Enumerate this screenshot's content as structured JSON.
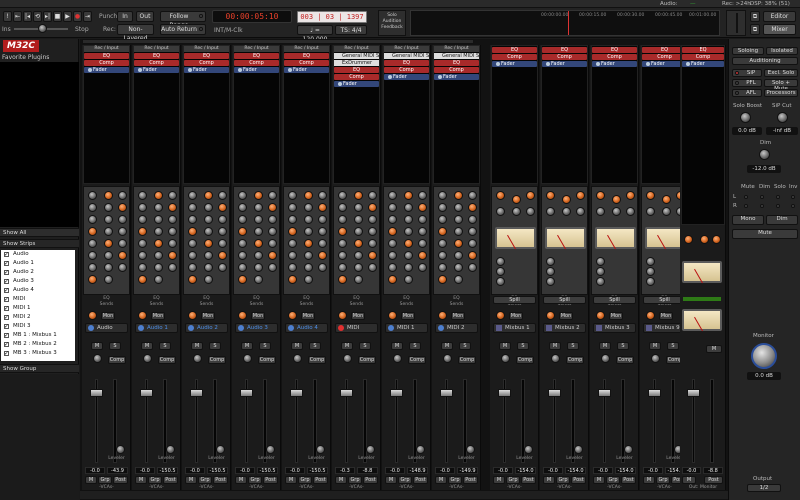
{
  "status": {
    "audio_label": "Audio:",
    "rec": "Rec: >24h",
    "dsp": "DSP: 38% (51)"
  },
  "toolbar": {
    "punch_label": "Punch:",
    "in": "In",
    "out": "Out",
    "follow_range": "Follow Range",
    "rec_label": "Rec:",
    "non_layered": "Non-Layered",
    "auto_return": "Auto Return",
    "timecode": "00:00:05:10",
    "bbt": "003 | 03 | 1397",
    "clock_source": "INT/M-Clk",
    "tempo": "♩ = 120.000",
    "timesig": "TS: 4/4",
    "solo": "Solo",
    "audition": "Audition",
    "feedback": "Feedback",
    "stop": "Stop",
    "ins_label": "Ins",
    "ruler": [
      "00:00:00.00",
      "00:00:15.00",
      "00:00:30.00",
      "00:00:45.00",
      "00:01:00.00"
    ],
    "editor": "Editor",
    "mixer": "Mixer"
  },
  "left": {
    "logo": "M32C",
    "favorites": "Favorite Plugins",
    "show_all": "Show All",
    "strips_header": "Show  Strips",
    "group_header": "Show  Group",
    "strips": [
      "Audio",
      "Audio 1",
      "Audio 2",
      "Audio 3",
      "Audio 4",
      "MIDI",
      "MIDI 1",
      "MIDI 2",
      "MIDI 3",
      "MB 1 : Mixbus 1",
      "MB 2 : Mixbus 2",
      "MB 3 : Mixbus 3"
    ]
  },
  "strips": [
    {
      "name": "Audio",
      "kind": "audio",
      "insert_hdr": "Rec / Input",
      "inserts": [
        "EQ",
        "Comp"
      ],
      "fader_val": "-0.0",
      "peak": "-43.9"
    },
    {
      "name": "Audio 1",
      "kind": "audio",
      "insert_hdr": "Rec / Input",
      "inserts": [
        "EQ",
        "Comp"
      ],
      "fader_val": "-0.0",
      "peak": "-150.5"
    },
    {
      "name": "Audio 2",
      "kind": "audio",
      "insert_hdr": "Rec / Input",
      "inserts": [
        "EQ",
        "Comp"
      ],
      "fader_val": "-0.0",
      "peak": "-150.5"
    },
    {
      "name": "Audio 3",
      "kind": "audio",
      "insert_hdr": "Rec / Input",
      "inserts": [
        "EQ",
        "Comp"
      ],
      "fader_val": "-0.0",
      "peak": "-150.5"
    },
    {
      "name": "Audio 4",
      "kind": "audio",
      "insert_hdr": "Rec / Input",
      "inserts": [
        "EQ",
        "Comp"
      ],
      "fader_val": "-0.0",
      "peak": "-150.5"
    },
    {
      "name": "MIDI",
      "kind": "midi",
      "insert_hdr": "Rec / Input",
      "inserts": [
        "General MIDI Sy",
        "ExDrummer",
        "EQ",
        "Comp"
      ],
      "fader_val": "-0.3",
      "peak": "-8.8"
    },
    {
      "name": "MIDI 1",
      "kind": "midi",
      "insert_hdr": "Rec / Input",
      "inserts": [
        "General MIDI Sy",
        "EQ",
        "Comp"
      ],
      "fader_val": "-0.0",
      "peak": "-148.9"
    },
    {
      "name": "MIDI 2",
      "kind": "midi",
      "insert_hdr": "Rec / Input",
      "inserts": [
        "General MIDI Sy",
        "EQ",
        "Comp"
      ],
      "fader_val": "-0.0",
      "peak": "-149.9"
    },
    {
      "name": "Mixbus 1",
      "kind": "bus",
      "insert_hdr": "",
      "inserts": [
        "EQ",
        "Comp"
      ],
      "fader_val": "-0.0",
      "peak": "-154.0"
    },
    {
      "name": "Mixbus 2",
      "kind": "bus",
      "insert_hdr": "",
      "inserts": [
        "EQ",
        "Comp"
      ],
      "fader_val": "-0.0",
      "peak": "-154.0"
    },
    {
      "name": "Mixbus 3",
      "kind": "bus",
      "insert_hdr": "",
      "inserts": [
        "EQ",
        "Comp"
      ],
      "fader_val": "-0.0",
      "peak": "-154.0"
    },
    {
      "name": "Mixbus 9",
      "kind": "bus",
      "insert_hdr": "",
      "inserts": [
        "EQ",
        "Comp"
      ],
      "fader_val": "-0.0",
      "peak": "-154.0"
    }
  ],
  "strip_labels": {
    "fader": "Fader",
    "eq": "EQ",
    "sends": "Sends",
    "mon": "Mon",
    "m": "M",
    "s": "S",
    "comp": "Comp",
    "grp": "Grp",
    "post": "Post",
    "vca": "-VCAs-",
    "spill": "Spill",
    "trim": "Trim",
    "width": "Width",
    "leveler": "Leveler"
  },
  "master": {
    "fader": "Fader",
    "inserts": [
      "EQ",
      "Comp"
    ],
    "fader_val": "-0.0",
    "peak": "-8.8",
    "out": "Out: Monitor",
    "m": "M",
    "post": "Post"
  },
  "right": {
    "soloing": "Soloing",
    "isolated": "Isolated",
    "auditioning": "Auditioning",
    "sip": "SiP",
    "excl_solo": "Excl. Solo",
    "pfl": "PFL",
    "solo_mute": "Solo + Mute",
    "afl": "AFL",
    "processors": "Processors",
    "solo_boost": "Solo Boost",
    "sip_cut": "SiP Cut",
    "boost_val": "0.0 dB",
    "cut_val": "-inf dB",
    "dim": "Dim",
    "dim_val": "-12.0 dB",
    "cols": [
      "Mute",
      "Dim",
      "Solo",
      "Inv"
    ],
    "l": "L",
    "r": "R",
    "mono": "Mono",
    "dim_btn": "Dim",
    "mute": "Mute",
    "monitor": "Monitor",
    "monitor_val": "0.0 dB",
    "output": "Output",
    "output_val": "1/2"
  }
}
